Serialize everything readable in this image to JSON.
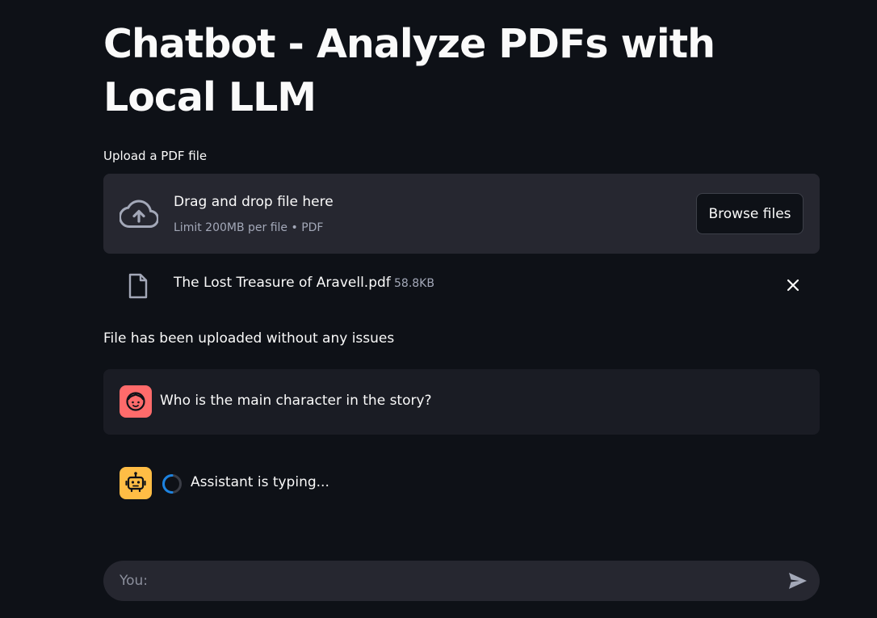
{
  "title": "Chatbot - Analyze PDFs with Local LLM",
  "uploader": {
    "label": "Upload a PDF file",
    "drop_title": "Drag and drop file here",
    "drop_subtitle": "Limit 200MB per file • PDF",
    "browse_label": "Browse files"
  },
  "uploaded_file": {
    "name": "The Lost Treasure of Aravell.pdf",
    "size": "58.8KB"
  },
  "status_message": "File has been uploaded without any issues",
  "messages": [
    {
      "role": "user",
      "text": "Who is the main character in the story?"
    },
    {
      "role": "assistant",
      "text": "Assistant is typing..."
    }
  ],
  "chat_input": {
    "placeholder": "You:",
    "value": ""
  },
  "colors": {
    "background": "#0e1117",
    "surface": "#262730",
    "user_avatar": "#ff6b6b",
    "assistant_avatar": "#ffbd45",
    "spinner_accent": "#1c83e1"
  },
  "icons": {
    "upload": "cloud-upload-icon",
    "file": "file-icon",
    "remove": "close-icon",
    "user": "user-face-icon",
    "assistant": "robot-icon",
    "send": "send-icon"
  }
}
